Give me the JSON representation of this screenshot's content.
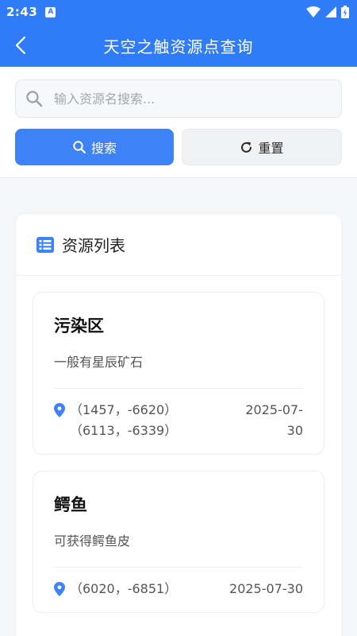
{
  "status_bar": {
    "time": "2:43",
    "badge": "A"
  },
  "header": {
    "title": "天空之触资源点查询"
  },
  "search": {
    "placeholder": "输入资源名搜索...",
    "value": ""
  },
  "buttons": {
    "search_label": "搜索",
    "reset_label": "重置"
  },
  "list": {
    "title": "资源列表",
    "items": [
      {
        "name": "污染区",
        "desc": "一般有星辰矿石",
        "coords": [
          "（1457，-6620）",
          "（6113，-6339）"
        ],
        "date": "2025-07-30"
      },
      {
        "name": "鳄鱼",
        "desc": "可获得鳄鱼皮",
        "coords": [
          "（6020，-6851）"
        ],
        "date": "2025-07-30"
      }
    ]
  },
  "colors": {
    "accent": "#2f7cf6",
    "button": "#3e82f7"
  }
}
